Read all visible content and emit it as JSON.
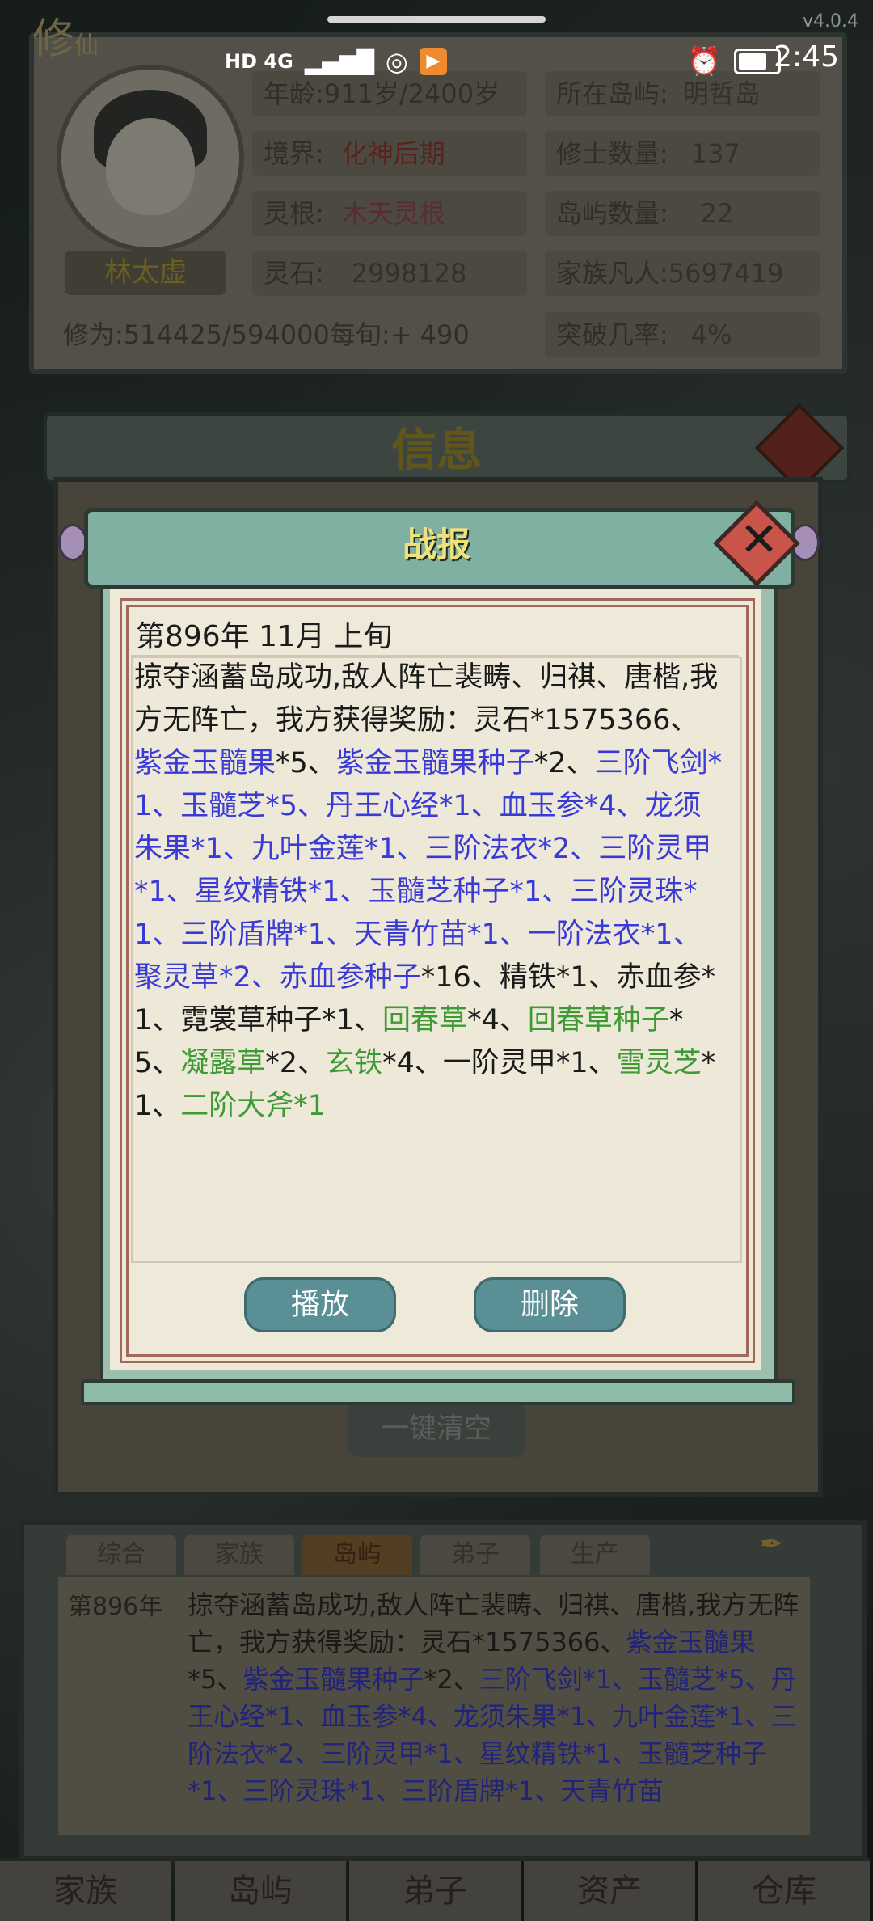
{
  "status": {
    "network": "HD 4G",
    "time": "2:45",
    "version": "v4.0.4"
  },
  "header": {
    "cultivate_char": "修",
    "cultivate_small": "仙"
  },
  "profile": {
    "name": "林太虚",
    "age_label": "年龄:911岁/2400岁",
    "realm_label": "境界:",
    "realm_value": "化神后期",
    "root_label": "灵根:",
    "root_value": "木天灵根",
    "stone_label": "灵石:",
    "stone_value": "2998128",
    "cultivation": "修为:514425/594000每旬:+ 490",
    "island_label": "所在岛屿:",
    "island_value": "明哲岛",
    "cultivators_label": "修士数量:",
    "cultivators_value": "137",
    "islands_label": "岛屿数量:",
    "islands_value": "22",
    "mortals_label": "家族凡人:",
    "mortals_value": "5697419",
    "breakthrough_label": "突破几率:",
    "breakthrough_value": "4%"
  },
  "info": {
    "title": "信息",
    "clear_all": "一键清空"
  },
  "dialog": {
    "title": "战报",
    "date": "第896年 11月 上旬",
    "report": [
      {
        "t": "掠夺涵蓄岛成功,敌人阵亡裴畴、归祺、唐楷,我方无阵亡，我方获得奖励：灵石*1575366、",
        "c": "black"
      },
      {
        "t": "紫金玉髓果",
        "c": "blue"
      },
      {
        "t": "*5、",
        "c": "black"
      },
      {
        "t": "紫金玉髓果种子",
        "c": "blue"
      },
      {
        "t": "*2、",
        "c": "black"
      },
      {
        "t": "三阶飞剑*1、玉髓芝*5、丹王心经*1、血玉参*4、龙须朱果*1、九叶金莲*1、三阶法衣*2、三阶灵甲*1、星纹精铁*1、玉髓芝种子*1、三阶灵珠*1、三阶盾牌*1、天青竹苗*1、一阶法衣*1、聚灵草*2、赤血参种子",
        "c": "blue"
      },
      {
        "t": "*16、精铁*1、赤血参*1、霓裳草种子*1、",
        "c": "black"
      },
      {
        "t": "回春草",
        "c": "green"
      },
      {
        "t": "*4、",
        "c": "black"
      },
      {
        "t": "回春草种子",
        "c": "green"
      },
      {
        "t": "*5、",
        "c": "black"
      },
      {
        "t": "凝露草",
        "c": "green"
      },
      {
        "t": "*2、",
        "c": "black"
      },
      {
        "t": "玄铁",
        "c": "green"
      },
      {
        "t": "*4、一阶灵甲*1、",
        "c": "black"
      },
      {
        "t": "雪灵芝",
        "c": "green"
      },
      {
        "t": "*1、",
        "c": "black"
      },
      {
        "t": "二阶大斧*1",
        "c": "green"
      }
    ],
    "play_label": "播放",
    "delete_label": "删除"
  },
  "log": {
    "tabs": [
      "综合",
      "家族",
      "岛屿",
      "弟子",
      "生产"
    ],
    "active_tab": 2,
    "year": "第896年",
    "text": [
      {
        "t": "掠夺涵蓄岛成功,敌人阵亡裴畴、归祺、唐楷,我方无阵亡，我方获得奖励：灵石*1575366、",
        "c": "black"
      },
      {
        "t": "紫金玉髓果",
        "c": "blue"
      },
      {
        "t": "*5、",
        "c": "black"
      },
      {
        "t": "紫金玉髓果种子",
        "c": "blue"
      },
      {
        "t": "*2、",
        "c": "black"
      },
      {
        "t": "三阶飞剑*1、玉髓芝*5、丹王心经*1、血玉参*4、龙须朱果*1、九叶金莲*1、三阶法衣*2、三阶灵甲*1、星纹精铁*1、玉髓芝种子*1、三阶灵珠*1、三阶盾牌*1、天青竹苗",
        "c": "blue"
      }
    ]
  },
  "nav": [
    "家族",
    "岛屿",
    "弟子",
    "资产",
    "仓库"
  ],
  "colors": {
    "blue": "#3a3bd6",
    "green": "#3e9a35",
    "title_gold": "#f0e27a",
    "button": "#5a8f95"
  }
}
